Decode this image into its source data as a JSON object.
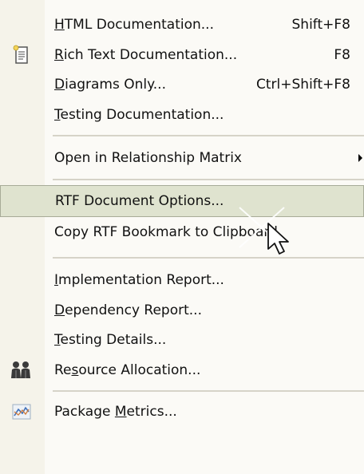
{
  "menu": {
    "items": [
      {
        "before": "",
        "key": "H",
        "after": "TML Documentation...",
        "shortcut": "Shift+F8"
      },
      {
        "before": "",
        "key": "R",
        "after": "ich Text Documentation...",
        "shortcut": "F8",
        "icon": "document-icon"
      },
      {
        "before": "",
        "key": "D",
        "after": "iagrams Only...",
        "shortcut": "Ctrl+Shift+F8"
      },
      {
        "before": "",
        "key": "T",
        "after": "esting Documentation...",
        "shortcut": ""
      },
      {
        "label": "Open in Relationship Matrix",
        "submenu": true
      },
      {
        "label": "RTF Document Options...",
        "highlighted": true
      },
      {
        "label": "Copy RTF Bookmark to Clipboard"
      },
      {
        "before": "",
        "key": "I",
        "after": "mplementation Report..."
      },
      {
        "before": "",
        "key": "D",
        "after": "ependency Report..."
      },
      {
        "before": "",
        "key": "T",
        "after": "esting Details..."
      },
      {
        "before": "Re",
        "key": "s",
        "after": "ource Allocation...",
        "icon": "people-icon"
      },
      {
        "before": "Package ",
        "key": "M",
        "after": "etrics...",
        "icon": "metrics-chart-icon"
      }
    ]
  }
}
